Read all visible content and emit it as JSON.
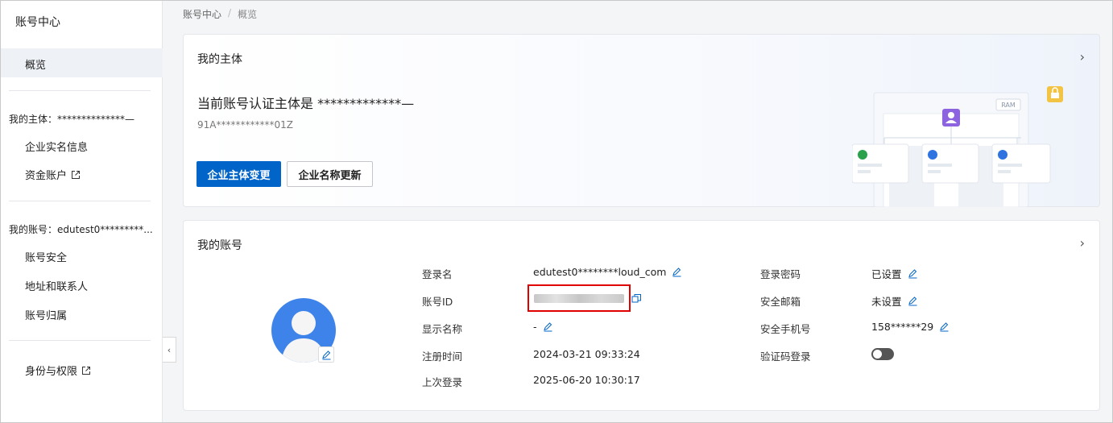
{
  "sidebar": {
    "title": "账号中心",
    "active_item": "概览",
    "entity_group": "我的主体：**************—",
    "entity_items": [
      "企业实名信息",
      "资金账户"
    ],
    "account_group": "我的账号：edutest0*********...",
    "account_items": [
      "账号安全",
      "地址和联系人",
      "账号归属"
    ],
    "identity_item": "身份与权限"
  },
  "breadcrumb": {
    "root": "账号中心",
    "separator": "/",
    "current": "概览"
  },
  "entity_card": {
    "title": "我的主体",
    "entity_name": "当前账号认证主体是 *************—",
    "entity_code": "91A************01Z",
    "primary_button": "企业主体变更",
    "secondary_button": "企业名称更新",
    "illustration_badge": "RAM"
  },
  "account_card": {
    "title": "我的账号",
    "left_fields": [
      {
        "label": "登录名",
        "value": "edutest0********loud_com"
      },
      {
        "label": "账号ID",
        "value": ""
      },
      {
        "label": "显示名称",
        "value": "-"
      },
      {
        "label": "注册时间",
        "value": "2024-03-21 09:33:24"
      },
      {
        "label": "上次登录",
        "value": "2025-06-20 10:30:17"
      }
    ],
    "right_fields": [
      {
        "label": "登录密码",
        "value": "已设置"
      },
      {
        "label": "安全邮箱",
        "value": "未设置"
      },
      {
        "label": "安全手机号",
        "value": "158******29"
      },
      {
        "label": "验证码登录",
        "value": ""
      }
    ],
    "otp_login_enabled": false
  },
  "colors": {
    "primary": "#0064c8",
    "avatar": "#3e83ea",
    "highlight": "#e00000"
  }
}
